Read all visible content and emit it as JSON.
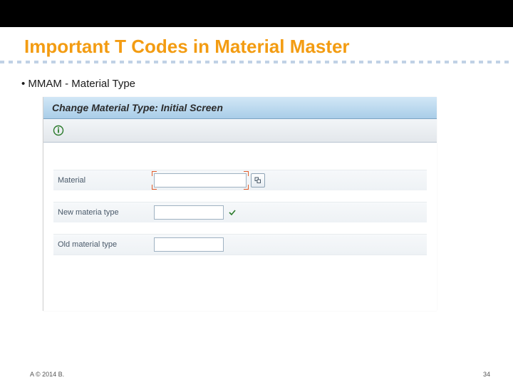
{
  "slide": {
    "title": "Important T Codes in Material Master",
    "bullet": "MMAM - Material Type",
    "footer_left": "A © 2014 B.",
    "footer_right": "34"
  },
  "sap": {
    "window_title": "Change Material Type: Initial Screen",
    "fields": {
      "material_label": "Material",
      "material_value": "",
      "new_type_label": "New materia type",
      "new_type_value": "",
      "old_type_label": "Old material type",
      "old_type_value": ""
    },
    "icons": {
      "toolbar_info": "info-icon",
      "search_help": "search-help-icon",
      "checkmark": "checkmark-icon"
    }
  }
}
